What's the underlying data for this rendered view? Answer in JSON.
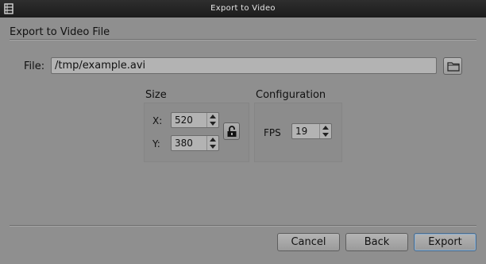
{
  "window": {
    "title": "Export to Video"
  },
  "section_title": "Export to Video File",
  "file": {
    "label": "File:",
    "value": "/tmp/example.avi"
  },
  "size": {
    "title": "Size",
    "x_label": "X:",
    "x_value": "520",
    "y_label": "Y:",
    "y_value": "380"
  },
  "configuration": {
    "title": "Configuration",
    "fps_label": "FPS",
    "fps_value": "19"
  },
  "buttons": {
    "cancel": "Cancel",
    "back": "Back",
    "export": "Export"
  },
  "icons": {
    "app": "film-strip-icon",
    "folder": "folder-icon",
    "lock": "unlock-icon"
  }
}
